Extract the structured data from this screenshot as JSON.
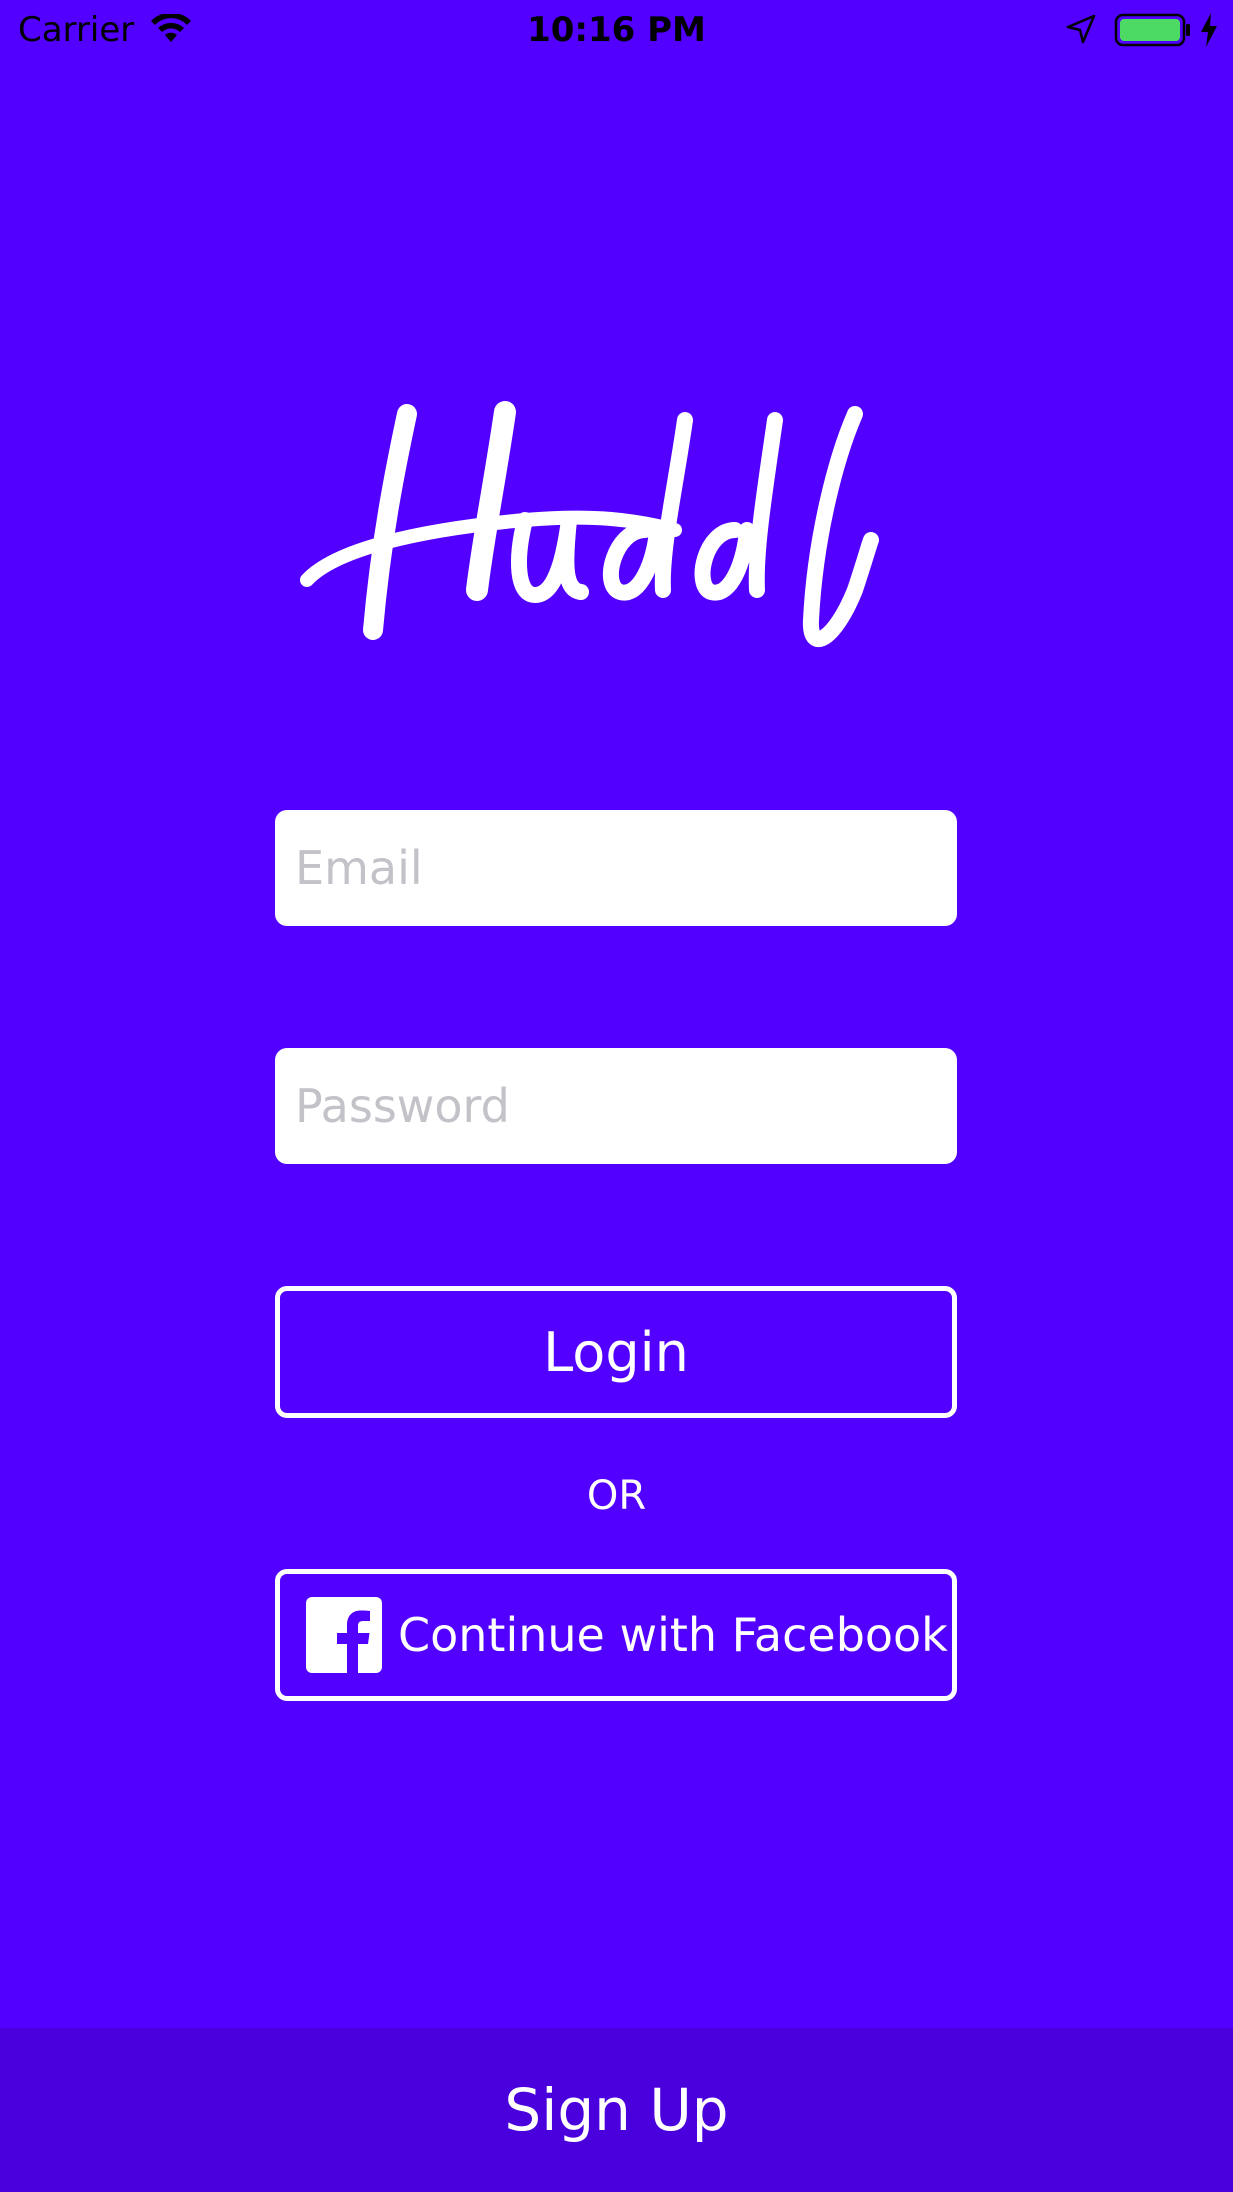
{
  "status_bar": {
    "carrier": "Carrier",
    "time": "10:16 PM",
    "icons": [
      "wifi-icon",
      "location-arrow-icon",
      "battery-icon",
      "charging-bolt-icon"
    ],
    "battery_color": "#4cd964"
  },
  "logo": {
    "text": "Huddl",
    "icon": "huddl-wordmark-logo"
  },
  "form": {
    "email_placeholder": "Email",
    "password_placeholder": "Password",
    "login_label": "Login",
    "or_label": "OR",
    "facebook_label": "Continue with Facebook",
    "facebook_icon": "facebook-icon"
  },
  "footer": {
    "signup_label": "Sign Up"
  },
  "colors": {
    "background": "#5200ff",
    "footer_background": "#4a00dd",
    "accent": "#ffffff"
  }
}
